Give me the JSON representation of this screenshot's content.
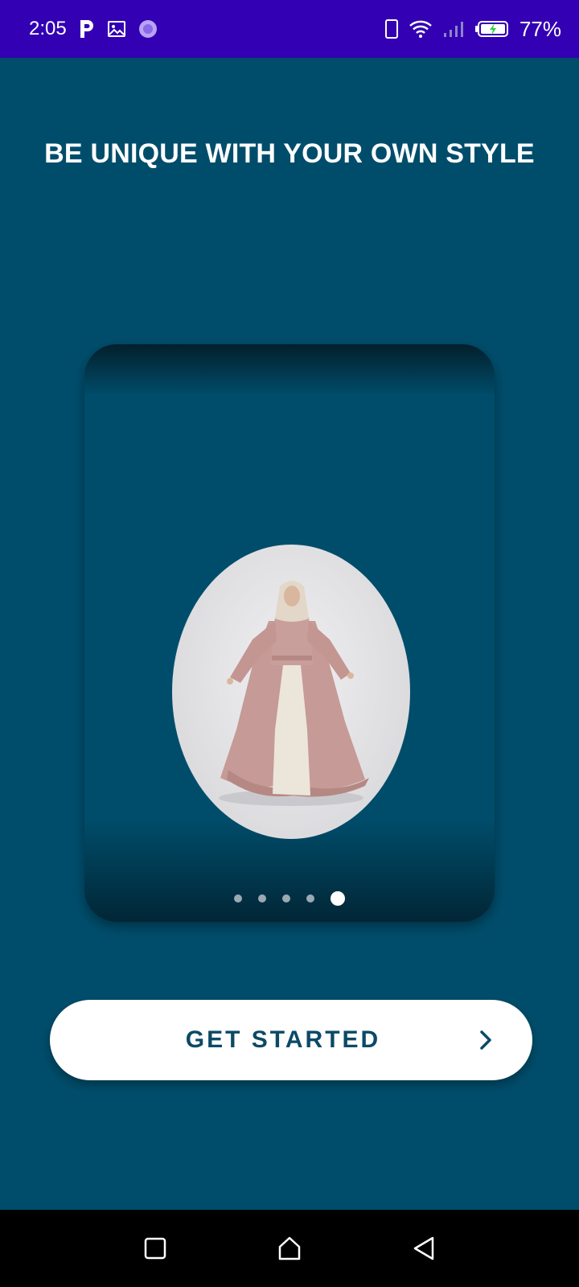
{
  "status_bar": {
    "time": "2:05",
    "battery_percent": "77%",
    "icons": [
      "parking-app-icon",
      "gallery-icon",
      "app-badge-icon",
      "phone-icon",
      "wifi-icon",
      "signal-icon",
      "battery-charging-icon"
    ]
  },
  "onboarding": {
    "headline": "BE UNIQUE WITH YOUR OWN STYLE",
    "image": "woman-in-abaya-photo",
    "page_indicator": {
      "total": 5,
      "current": 5
    },
    "cta_label": "GET STARTED",
    "cta_icon": "chevron-right-icon"
  },
  "nav_bar": {
    "buttons": [
      "recents-button",
      "home-button",
      "back-button"
    ]
  },
  "colors": {
    "status_bar": "#3300b3",
    "background": "#004d6b",
    "button": "#ffffff",
    "button_text": "#0b4a66",
    "nav_bar": "#000000"
  }
}
